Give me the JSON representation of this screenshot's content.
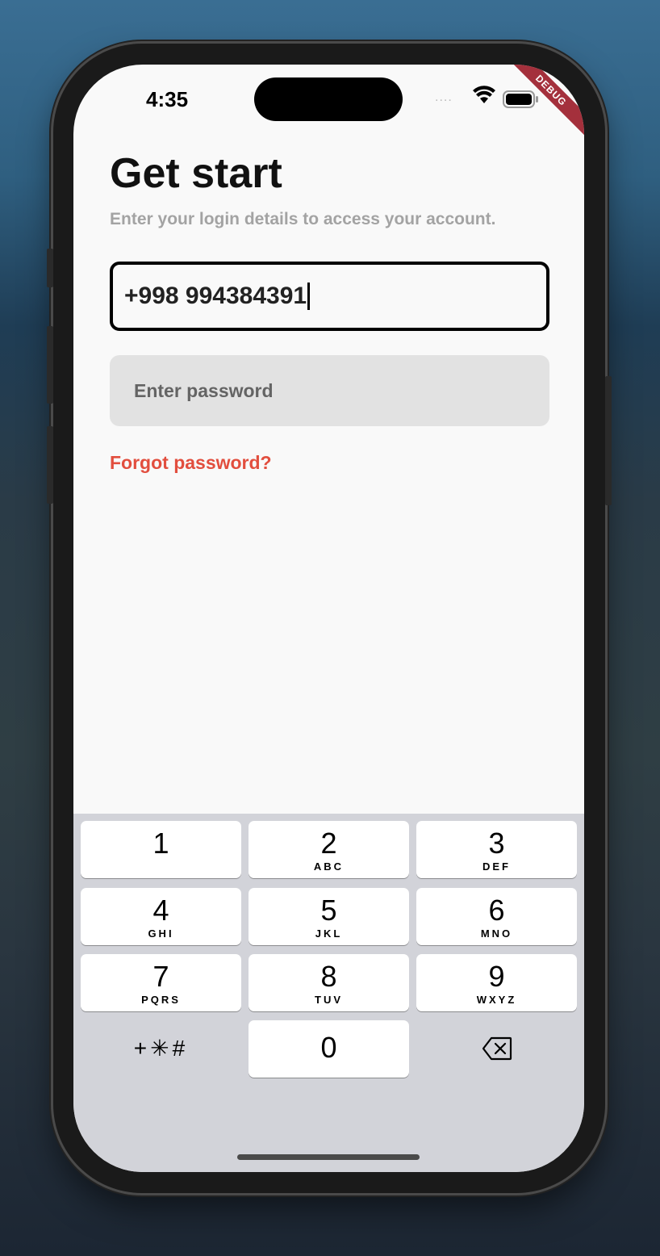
{
  "status_bar": {
    "time": "4:35",
    "signal_dots": "....",
    "wifi_icon": "wifi-icon",
    "battery_icon": "battery-icon"
  },
  "debug_banner": "DEBUG",
  "login": {
    "title": "Get start",
    "subtitle": "Enter your login details to access your account.",
    "phone_value": "+998 994384391",
    "password_placeholder": "Enter password",
    "forgot_link": "Forgot password?"
  },
  "keypad": {
    "keys": [
      {
        "digit": "1",
        "letters": ""
      },
      {
        "digit": "2",
        "letters": "ABC"
      },
      {
        "digit": "3",
        "letters": "DEF"
      },
      {
        "digit": "4",
        "letters": "GHI"
      },
      {
        "digit": "5",
        "letters": "JKL"
      },
      {
        "digit": "6",
        "letters": "MNO"
      },
      {
        "digit": "7",
        "letters": "PQRS"
      },
      {
        "digit": "8",
        "letters": "TUV"
      },
      {
        "digit": "9",
        "letters": "WXYZ"
      },
      {
        "digit": "0",
        "letters": ""
      }
    ],
    "symbols_label": "+✳#",
    "backspace_icon": "backspace-icon"
  },
  "colors": {
    "accent": "#e24e3e",
    "field_border": "#000000",
    "field_fill": "#e2e2e2",
    "debug_banner": "#a4303c"
  }
}
